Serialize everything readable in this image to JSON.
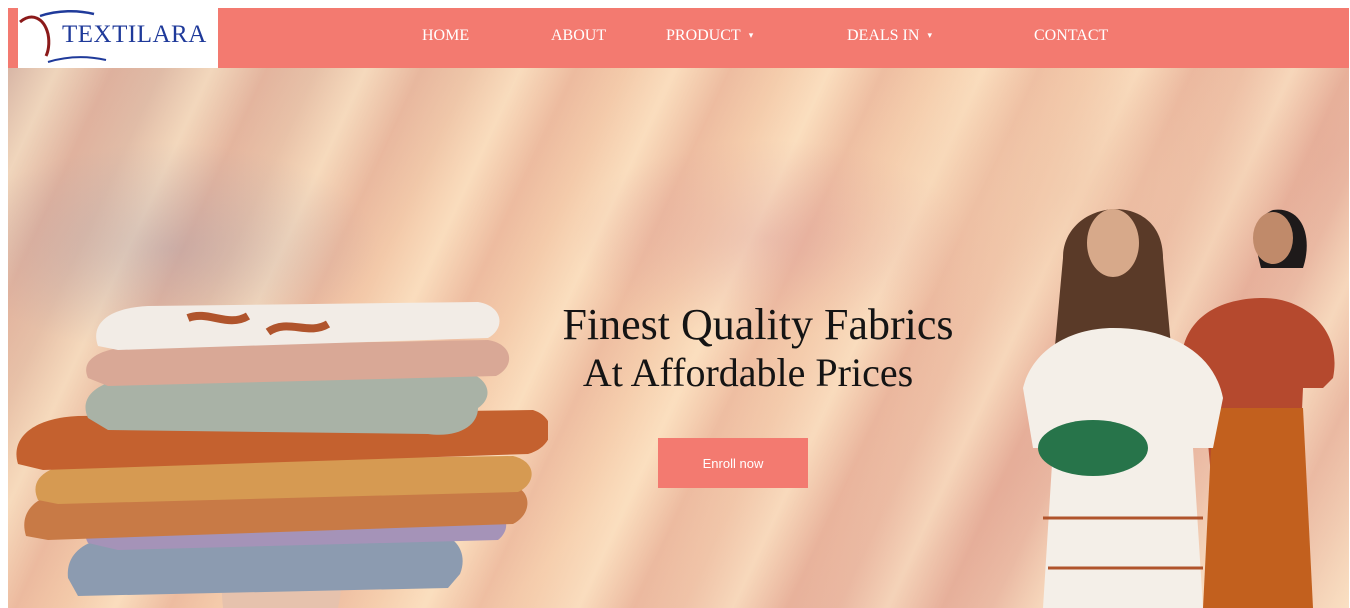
{
  "brand": {
    "name": "TEXTILARA"
  },
  "nav": {
    "items": [
      {
        "label": "HOME"
      },
      {
        "label": "ABOUT"
      },
      {
        "label": "PRODUCT",
        "caret": "▾"
      },
      {
        "label": "DEALS IN",
        "caret": "▾"
      },
      {
        "label": "CONTACT"
      }
    ]
  },
  "hero": {
    "headline_line1": "Finest Quality Fabrics",
    "headline_line2": "At Affordable Prices",
    "cta_label": "Enroll now"
  },
  "colors": {
    "accent": "#f37a70",
    "brand_text": "#1f3a9a",
    "headline": "#141414"
  }
}
